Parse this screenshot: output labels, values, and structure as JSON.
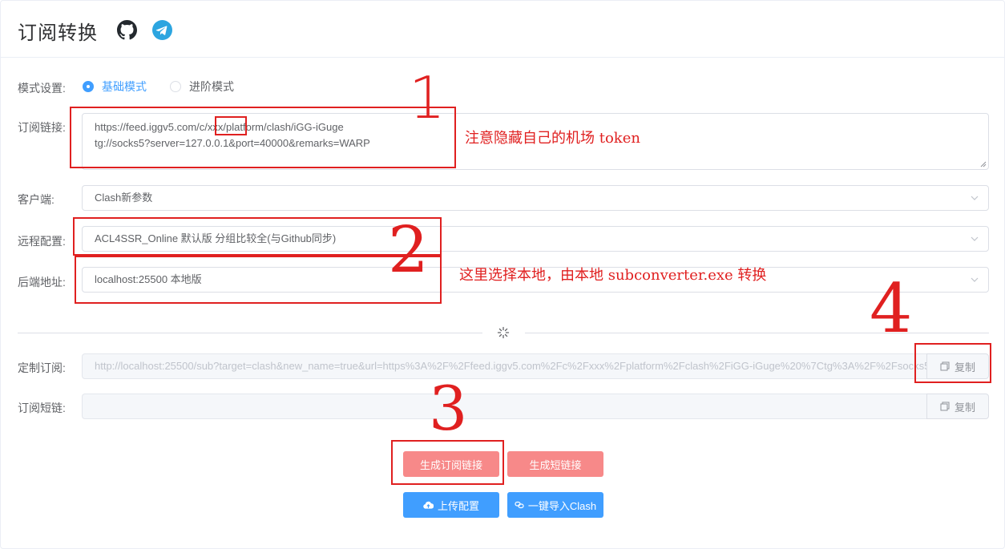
{
  "header": {
    "title": "订阅转换",
    "github_icon": "github-icon",
    "telegram_icon": "telegram-icon"
  },
  "mode": {
    "label": "模式设置:",
    "options": [
      {
        "label": "基础模式",
        "checked": true
      },
      {
        "label": "进阶模式",
        "checked": false
      }
    ]
  },
  "subscription": {
    "label": "订阅链接:",
    "lines": [
      "https://feed.iggv5.com/c/xxx/platform/clash/iGG-iGuge",
      "tg://socks5?server=127.0.0.1&port=40000&remarks=WARP"
    ]
  },
  "client": {
    "label": "客户端:",
    "value": "Clash新参数"
  },
  "remote_config": {
    "label": "远程配置:",
    "value": "ACL4SSR_Online 默认版 分组比较全(与Github同步)"
  },
  "backend": {
    "label": "后端地址:",
    "value": "localhost:25500 本地版"
  },
  "custom_sub": {
    "label": "定制订阅:",
    "value": "http://localhost:25500/sub?target=clash&new_name=true&url=https%3A%2F%2Ffeed.iggv5.com%2Fc%2Fxxx%2Fplatform%2Fclash%2FiGG-iGuge%20%7Ctg%3A%2F%2Fsocks5",
    "copy_label": "复制"
  },
  "short_link": {
    "label": "订阅短链:",
    "value": "",
    "copy_label": "复制"
  },
  "buttons": {
    "generate_sub": "生成订阅链接",
    "generate_short": "生成短链接",
    "upload_config": "上传配置",
    "import_clash": "一键导入Clash"
  },
  "annotations": {
    "num1": "1",
    "num2": "2",
    "num3": "3",
    "num4": "4",
    "note1": "注意隐藏自己的机场 token",
    "note2": "这里选择本地，由本地 subconverter.exe 转换"
  },
  "colors": {
    "primary": "#409eff",
    "danger": "#f78989",
    "annotation": "#e02020"
  }
}
